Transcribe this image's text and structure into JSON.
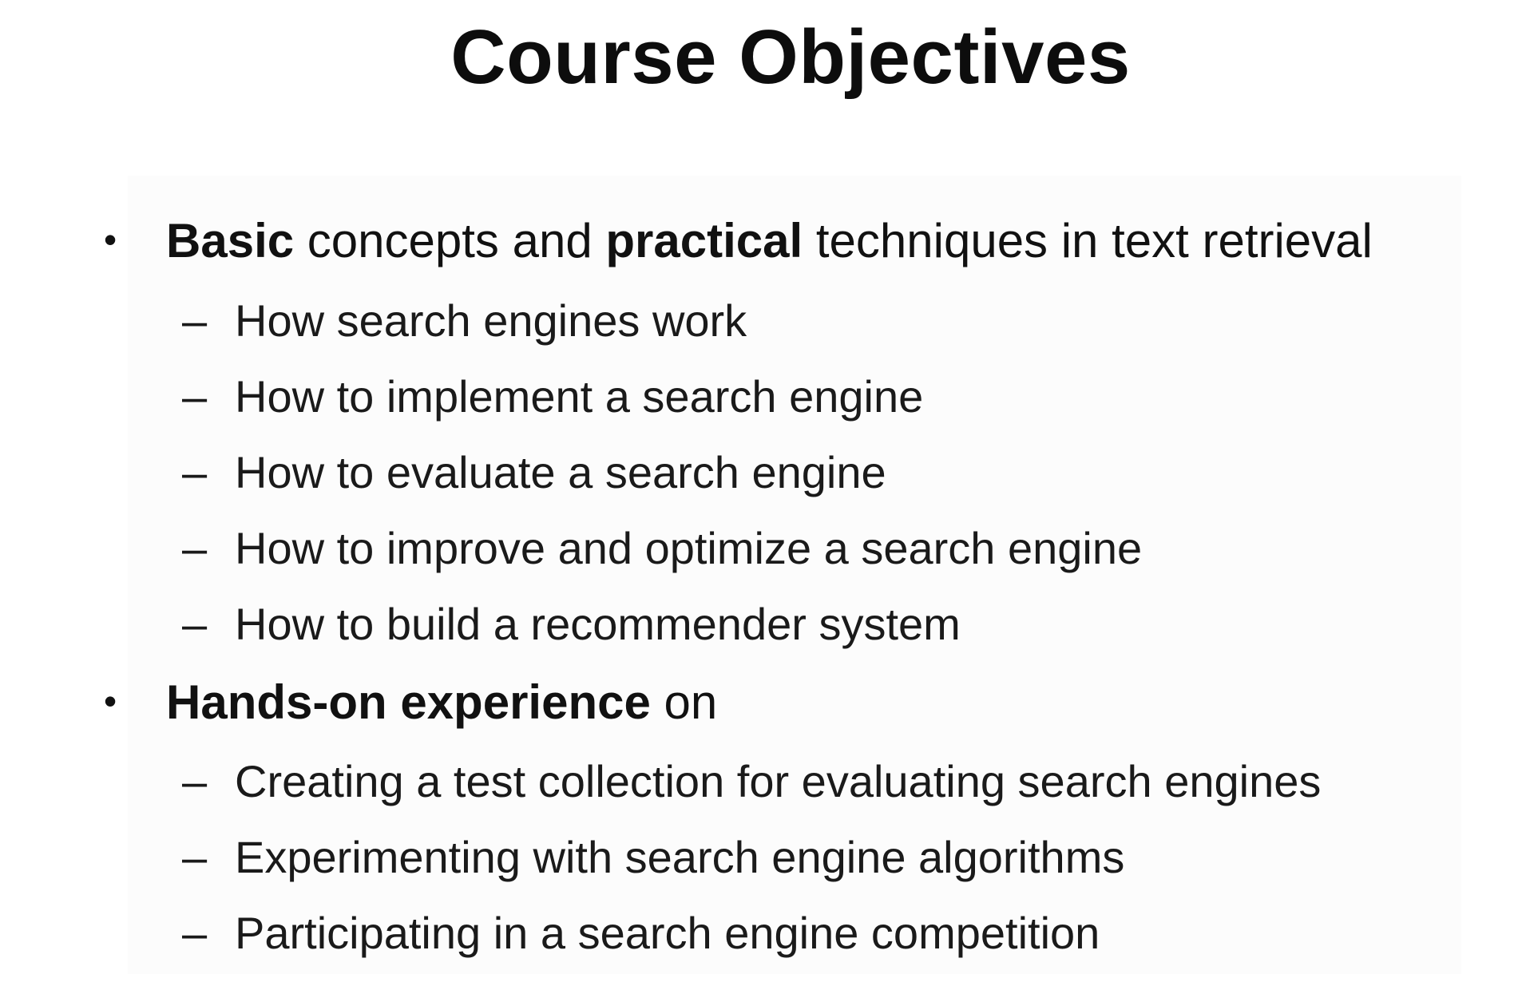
{
  "slide": {
    "title": "Course Objectives",
    "bullets": [
      {
        "marker": "•",
        "bold_1": "Basic",
        "text_1": " concepts and ",
        "bold_2": "practical",
        "text_2": " techniques in text retrieval",
        "subitems": [
          "How search engines work",
          "How to implement a search engine",
          "How to evaluate a search engine",
          "How to improve and optimize a search engine",
          "How to build a recommender system"
        ]
      },
      {
        "marker": "•",
        "bold_1": "Hands-on experience",
        "text_1": " on",
        "subitems": [
          "Creating a test collection for evaluating search engines",
          "Experimenting with search engine algorithms",
          "Participating in a search engine competition"
        ]
      }
    ],
    "sub_marker": "–"
  }
}
